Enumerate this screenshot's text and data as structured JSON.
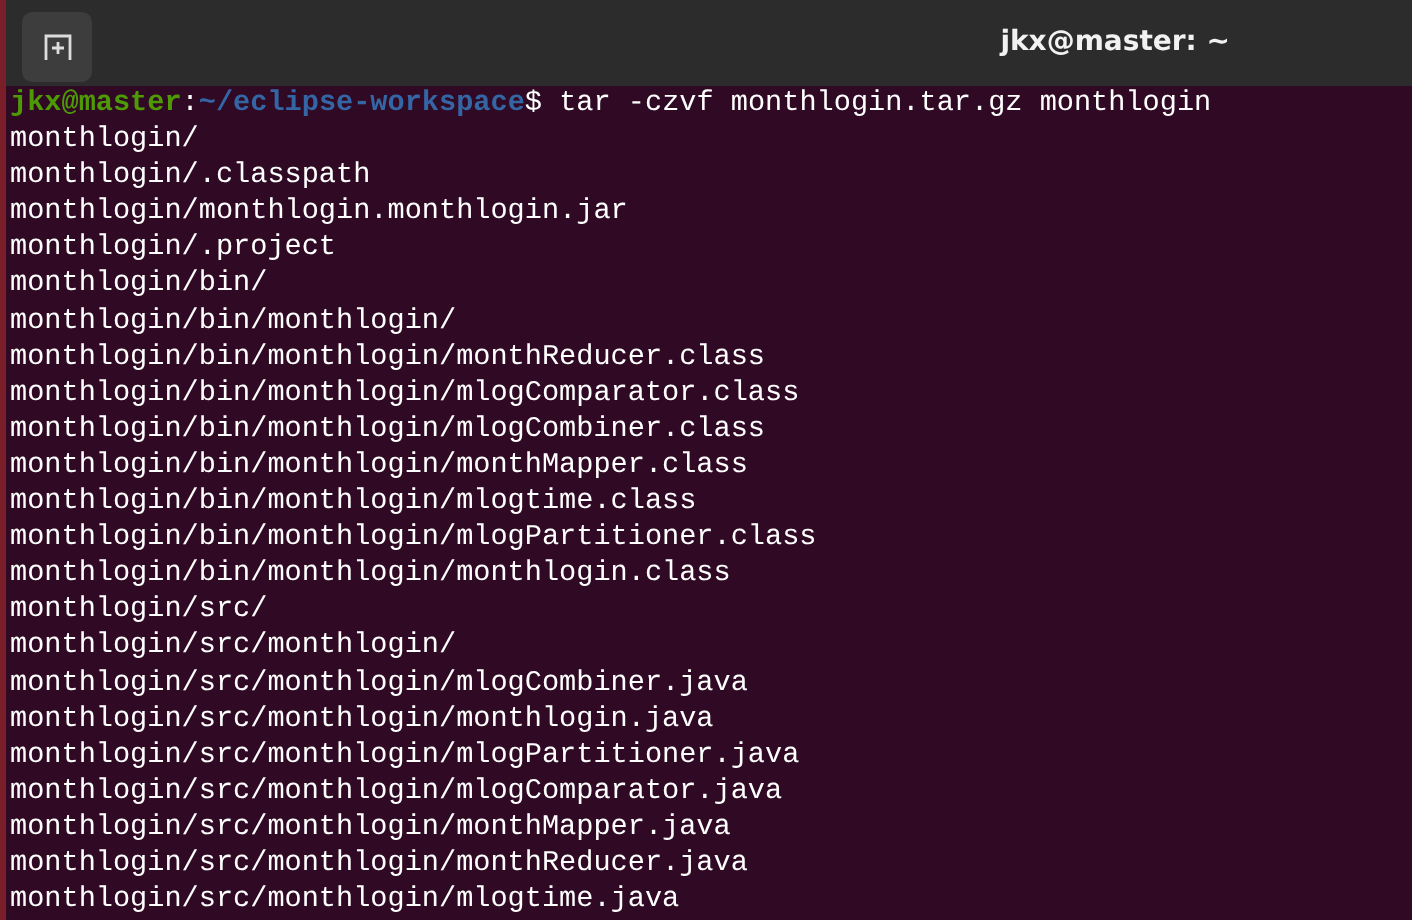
{
  "window": {
    "title": "jkx@master: ~"
  },
  "prompt": {
    "user_host": "jkx@master",
    "separator": ":",
    "path": "~/eclipse-workspace",
    "symbol": "$",
    "command": "tar -czvf monthlogin.tar.gz monthlogin"
  },
  "output": [
    "monthlogin/",
    "monthlogin/.classpath",
    "monthlogin/monthlogin.monthlogin.jar",
    "monthlogin/.project",
    "monthlogin/bin/",
    "monthlogin/bin/monthlogin/",
    "monthlogin/bin/monthlogin/monthReducer.class",
    "monthlogin/bin/monthlogin/mlogComparator.class",
    "monthlogin/bin/monthlogin/mlogCombiner.class",
    "monthlogin/bin/monthlogin/monthMapper.class",
    "monthlogin/bin/monthlogin/mlogtime.class",
    "monthlogin/bin/monthlogin/mlogPartitioner.class",
    "monthlogin/bin/monthlogin/monthlogin.class",
    "monthlogin/src/",
    "monthlogin/src/monthlogin/",
    "monthlogin/src/monthlogin/mlogCombiner.java",
    "monthlogin/src/monthlogin/monthlogin.java",
    "monthlogin/src/monthlogin/mlogPartitioner.java",
    "monthlogin/src/monthlogin/mlogComparator.java",
    "monthlogin/src/monthlogin/monthMapper.java",
    "monthlogin/src/monthlogin/monthReducer.java",
    "monthlogin/src/monthlogin/mlogtime.java"
  ]
}
